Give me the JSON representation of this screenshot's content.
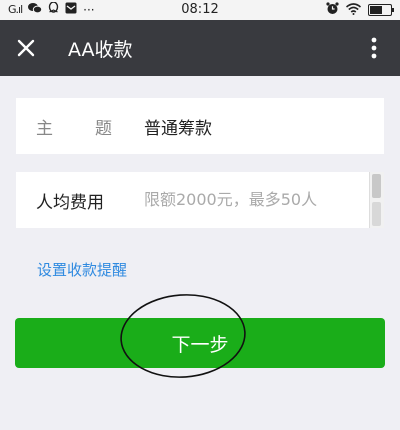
{
  "status_bar": {
    "signal": "G.ıl",
    "time": "08:12",
    "more_notifications": "···",
    "battery_level": 0.6
  },
  "header": {
    "title": "AA收款"
  },
  "form": {
    "subject_label": "主 题",
    "subject_label_chars": [
      "主",
      "题"
    ],
    "subject_value": "普通筹款",
    "amount_label": "人均费用",
    "amount_placeholder": "限额2000元，最多50人"
  },
  "reminder_link": "设置收款提醒",
  "next_button_label": "下一步",
  "colors": {
    "header_bg": "#393a3f",
    "button_green": "#1aad19",
    "link_blue": "#2f8ae0",
    "page_bg": "#efeff4"
  },
  "icons": [
    "close-icon",
    "more-vertical-icon",
    "alarm-icon",
    "wifi-icon",
    "battery-icon",
    "wechat-icon",
    "qq-icon",
    "mail-icon"
  ]
}
